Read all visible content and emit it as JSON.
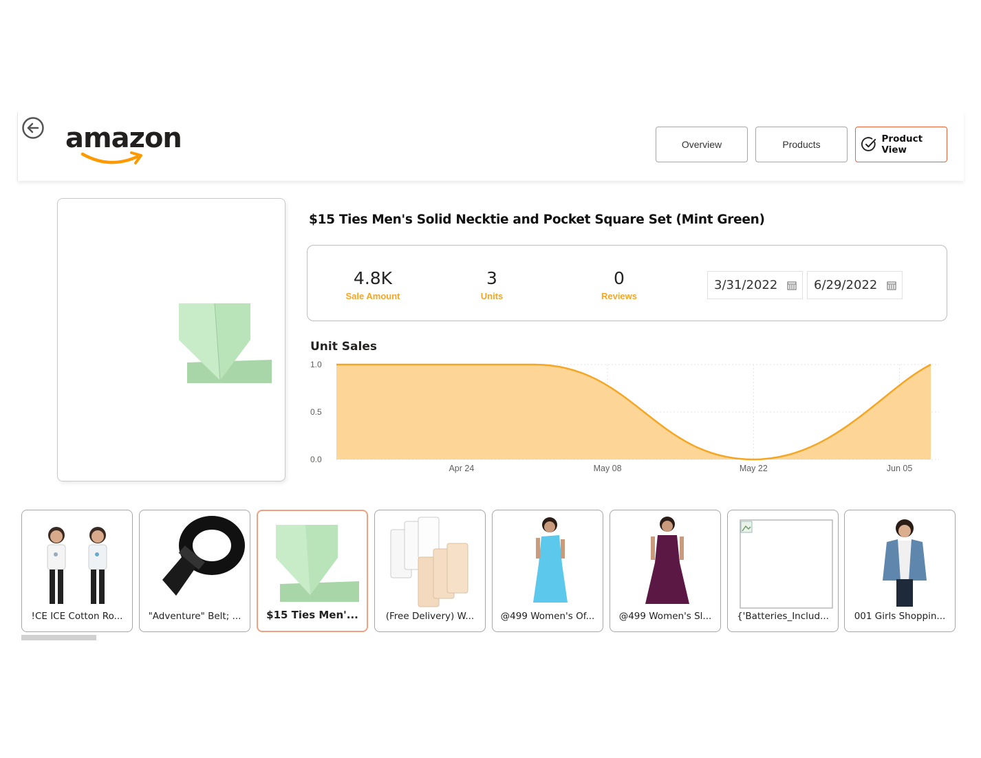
{
  "header": {
    "logo_text": "amazon",
    "nav": {
      "overview": "Overview",
      "products": "Products",
      "product_view": "Product View"
    }
  },
  "product": {
    "title": "$15 Ties Men's Solid Necktie and Pocket Square Set (Mint Green)"
  },
  "kpis": {
    "sale_amount": {
      "value": "4.8K",
      "label": "Sale Amount"
    },
    "units": {
      "value": "3",
      "label": "Units"
    },
    "reviews": {
      "value": "0",
      "label": "Reviews"
    }
  },
  "date_range": {
    "start": "3/31/2022",
    "end": "6/29/2022"
  },
  "chart_data": {
    "type": "area",
    "title": "Unit Sales",
    "xlabel": "",
    "ylabel": "",
    "x": [
      "2022-04-12",
      "2022-05-01",
      "2022-05-22",
      "2022-06-08"
    ],
    "values": [
      1,
      1,
      0,
      1
    ],
    "x_ticks": [
      "Apr 24",
      "May 08",
      "May 22",
      "Jun 05"
    ],
    "y_ticks": [
      "0.0",
      "0.5",
      "1.0"
    ],
    "ylim": [
      0,
      1
    ],
    "grid": true,
    "color": "#f5a623",
    "fill_color": "#fdd597"
  },
  "carousel": {
    "items": [
      {
        "label": "!CE ICE Cotton Ro...",
        "icon": "kids-tshirts-image"
      },
      {
        "label": "\"Adventure\" Belt; ...",
        "icon": "belt-image"
      },
      {
        "label": "$15 Ties Men'...",
        "icon": "tie-image",
        "selected": true
      },
      {
        "label": "(Free Delivery) W...",
        "icon": "bra-extender-image"
      },
      {
        "label": "@499 Women's Of...",
        "icon": "blue-dress-image"
      },
      {
        "label": "@499 Women's Sl...",
        "icon": "purple-dress-image"
      },
      {
        "label": "{'Batteries_Includ...",
        "icon": "broken-image"
      },
      {
        "label": "001 Girls Shoppin...",
        "icon": "denim-vest-image"
      }
    ]
  },
  "colors": {
    "accent_orange": "#f5a623",
    "selected_border": "#e8653a"
  }
}
